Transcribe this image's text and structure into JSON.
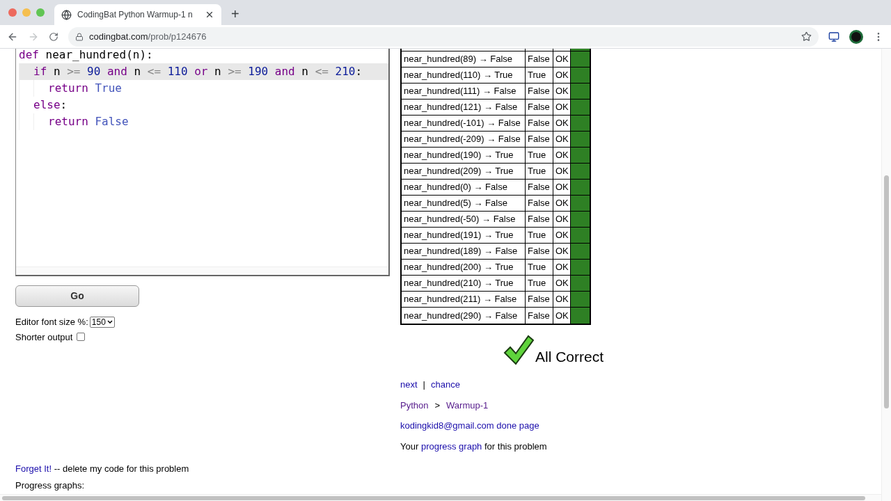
{
  "browser": {
    "tab_title": "CodingBat Python Warmup-1 n",
    "new_tab": "+",
    "url_host": "codingbat.com",
    "url_path": "/prob/p124676"
  },
  "editor": {
    "lines": [
      {
        "active": false,
        "tokens": [
          {
            "kind": "keyword",
            "text": "def"
          },
          {
            "kind": "name",
            "text": " near_hundred(n):"
          }
        ],
        "children": [
          {
            "active": true,
            "tokens": [
              {
                "kind": "keyword",
                "text": "if"
              },
              {
                "kind": "name",
                "text": " n "
              },
              {
                "kind": "op",
                "text": ">="
              },
              {
                "kind": "number",
                "text": " 90 "
              },
              {
                "kind": "keyword",
                "text": "and"
              },
              {
                "kind": "name",
                "text": " n "
              },
              {
                "kind": "op",
                "text": "<="
              },
              {
                "kind": "number",
                "text": " 110 "
              },
              {
                "kind": "keyword",
                "text": "or"
              },
              {
                "kind": "name",
                "text": " n "
              },
              {
                "kind": "op",
                "text": ">="
              },
              {
                "kind": "number",
                "text": " 190 "
              },
              {
                "kind": "keyword",
                "text": "and"
              },
              {
                "kind": "name",
                "text": " n "
              },
              {
                "kind": "op",
                "text": "<="
              },
              {
                "kind": "number",
                "text": " 210"
              },
              {
                "kind": "name",
                "text": ":"
              }
            ],
            "children": [
              {
                "active": false,
                "tokens": [
                  {
                    "kind": "keyword",
                    "text": "return"
                  },
                  {
                    "kind": "builtin",
                    "text": " True"
                  }
                ]
              }
            ]
          },
          {
            "active": false,
            "tokens": [
              {
                "kind": "keyword",
                "text": "else"
              },
              {
                "kind": "name",
                "text": ":"
              }
            ],
            "children": [
              {
                "active": false,
                "tokens": [
                  {
                    "kind": "keyword",
                    "text": "return"
                  },
                  {
                    "kind": "builtin",
                    "text": " False"
                  }
                ]
              }
            ]
          }
        ]
      }
    ]
  },
  "go_button": "Go",
  "font_size": {
    "label": "Editor font size %:",
    "value": "150"
  },
  "shorter_output": {
    "label": "Shorter output",
    "checked": false
  },
  "results": [
    {
      "expected": "near_hundred(89) → False",
      "run": "False",
      "status": "OK",
      "passed": true
    },
    {
      "expected": "near_hundred(110) → True",
      "run": "True",
      "status": "OK",
      "passed": true
    },
    {
      "expected": "near_hundred(111) → False",
      "run": "False",
      "status": "OK",
      "passed": true
    },
    {
      "expected": "near_hundred(121) → False",
      "run": "False",
      "status": "OK",
      "passed": true
    },
    {
      "expected": "near_hundred(-101) → False",
      "run": "False",
      "status": "OK",
      "passed": true
    },
    {
      "expected": "near_hundred(-209) → False",
      "run": "False",
      "status": "OK",
      "passed": true
    },
    {
      "expected": "near_hundred(190) → True",
      "run": "True",
      "status": "OK",
      "passed": true
    },
    {
      "expected": "near_hundred(209) → True",
      "run": "True",
      "status": "OK",
      "passed": true
    },
    {
      "expected": "near_hundred(0) → False",
      "run": "False",
      "status": "OK",
      "passed": true
    },
    {
      "expected": "near_hundred(5) → False",
      "run": "False",
      "status": "OK",
      "passed": true
    },
    {
      "expected": "near_hundred(-50) → False",
      "run": "False",
      "status": "OK",
      "passed": true
    },
    {
      "expected": "near_hundred(191) → True",
      "run": "True",
      "status": "OK",
      "passed": true
    },
    {
      "expected": "near_hundred(189) → False",
      "run": "False",
      "status": "OK",
      "passed": true
    },
    {
      "expected": "near_hundred(200) → True",
      "run": "True",
      "status": "OK",
      "passed": true
    },
    {
      "expected": "near_hundred(210) → True",
      "run": "True",
      "status": "OK",
      "passed": true
    },
    {
      "expected": "near_hundred(211) → False",
      "run": "False",
      "status": "OK",
      "passed": true
    },
    {
      "expected": "near_hundred(290) → False",
      "run": "False",
      "status": "OK",
      "passed": true
    }
  ],
  "verdict": "All Correct",
  "nav_links": {
    "next": "next",
    "separator": "|",
    "chance": "chance"
  },
  "breadcrumb": {
    "section": "Python",
    "separator": ">",
    "page": "Warmup-1"
  },
  "done_page": "kodingkid8@gmail.com done page",
  "progress": {
    "before": "Your",
    "link": "progress graph",
    "after": "for this problem"
  },
  "forget": {
    "link": "Forget It!",
    "text": "-- delete my code for this problem"
  },
  "progress_graphs": "Progress graphs:"
}
